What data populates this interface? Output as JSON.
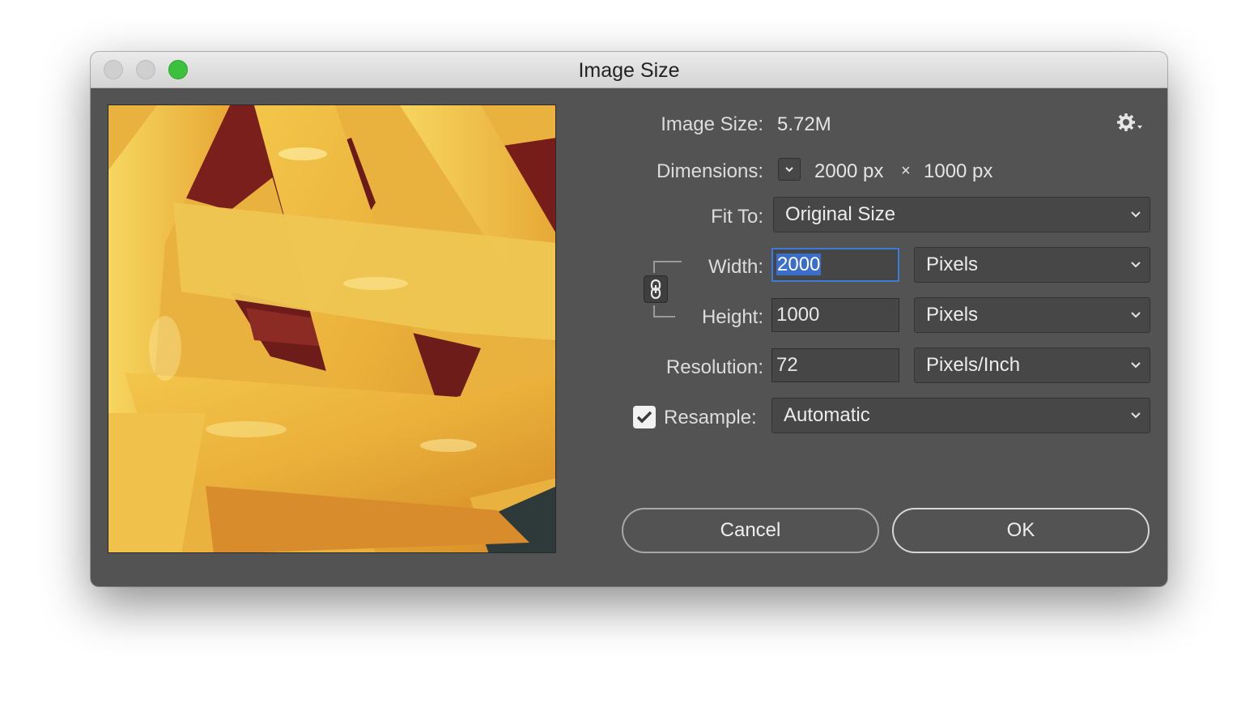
{
  "window": {
    "title": "Image Size"
  },
  "info": {
    "image_size_label": "Image Size:",
    "image_size_value": "5.72M",
    "dimensions_label": "Dimensions:",
    "dim_width": "2000 px",
    "dim_times": "×",
    "dim_height": "1000 px"
  },
  "fit_to": {
    "label": "Fit To:",
    "value": "Original Size"
  },
  "width": {
    "label": "Width:",
    "value": "2000",
    "unit": "Pixels"
  },
  "height": {
    "label": "Height:",
    "value": "1000",
    "unit": "Pixels"
  },
  "resolution": {
    "label": "Resolution:",
    "value": "72",
    "unit": "Pixels/Inch"
  },
  "resample": {
    "label": "Resample:",
    "checked": true,
    "value": "Automatic"
  },
  "buttons": {
    "cancel": "Cancel",
    "ok": "OK"
  },
  "colors": {
    "dialog_bg": "#535353",
    "focus": "#3d7bd9",
    "zoom_green": "#3cc13f"
  },
  "icons": [
    "gear-icon",
    "link-icon",
    "chevron-down-icon",
    "checkmark-icon"
  ]
}
